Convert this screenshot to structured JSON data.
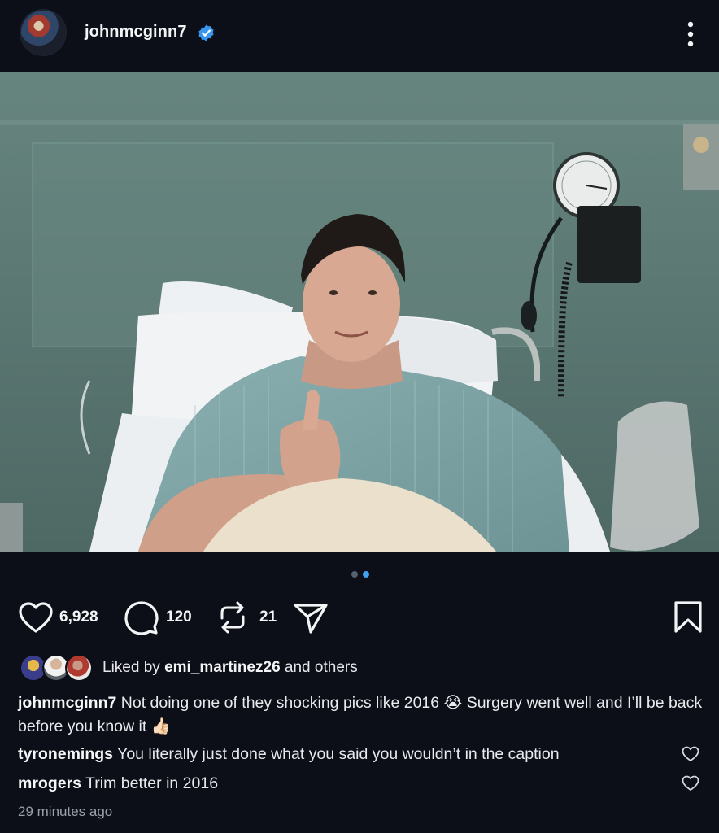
{
  "post": {
    "username": "johnmcginn7",
    "avatar_icon": "avatar-photo",
    "verified_icon": "verified-badge-icon",
    "more_icon": "more-vertical-icon",
    "photo_alt": "hospital-selfie-photo",
    "carousel": {
      "count": 2,
      "active_index": 1
    }
  },
  "actions": {
    "like_count": "6,928",
    "comment_count": "120",
    "repost_count": "21",
    "icons": [
      "heart-icon",
      "comment-icon",
      "repost-icon",
      "share-icon",
      "bookmark-icon"
    ]
  },
  "likes": {
    "prefix": "Liked by",
    "user": "emi_martinez26",
    "suffix": "and others"
  },
  "caption": {
    "username": "johnmcginn7",
    "text_part1": "Not doing one of they shocking pics like 2016",
    "emoji1": "😭",
    "text_part2": "Surgery went well and I’ll be back before you know it",
    "emoji2": "👍🏻"
  },
  "comments": [
    {
      "username": "tyronemings",
      "text": "You literally just done what you said you wouldn’t in the caption"
    },
    {
      "username": "mrogers",
      "text": "Trim better in 2016"
    }
  ],
  "timestamp": "29 minutes ago",
  "colors": {
    "background": "#0c0f17",
    "accent": "#3ea1f2",
    "verified": "#3797f0"
  }
}
